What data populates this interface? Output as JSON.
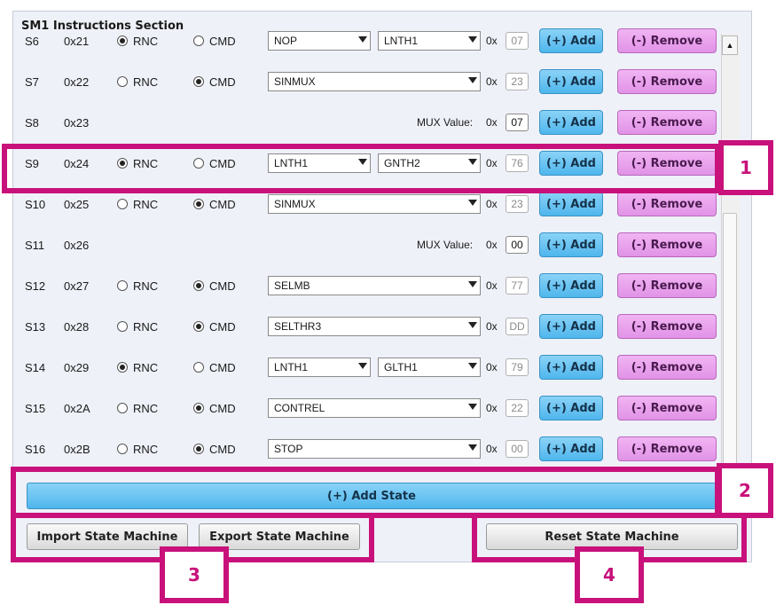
{
  "section_title": "SM1 Instructions Section",
  "labels": {
    "rnc": "RNC",
    "cmd": "CMD",
    "ox": "0x",
    "mux_value": "MUX Value:"
  },
  "buttons": {
    "add": "(+) Add",
    "remove": "(-) Remove",
    "add_state": "(+) Add State",
    "import": "Import State Machine",
    "export": "Export State Machine",
    "reset": "Reset State Machine"
  },
  "callouts": [
    "1",
    "2",
    "3",
    "4"
  ],
  "colors": {
    "highlight": "#c8117a",
    "add_blue": "#4fb6ec",
    "remove_pink": "#e193e6"
  },
  "rows": [
    {
      "id": "S6",
      "hex": "0x21",
      "mode": "RNC",
      "dd1": "NOP",
      "dd2": "LNTH1",
      "value": "07"
    },
    {
      "id": "S7",
      "hex": "0x22",
      "mode": "CMD",
      "dd1": "SINMUX",
      "value": "23"
    },
    {
      "id": "S8",
      "hex": "0x23",
      "mode": "MUX",
      "value": "07"
    },
    {
      "id": "S9",
      "hex": "0x24",
      "mode": "RNC",
      "dd1": "LNTH1",
      "dd2": "GNTH2",
      "value": "76"
    },
    {
      "id": "S10",
      "hex": "0x25",
      "mode": "CMD",
      "dd1": "SINMUX",
      "value": "23"
    },
    {
      "id": "S11",
      "hex": "0x26",
      "mode": "MUX",
      "value": "00"
    },
    {
      "id": "S12",
      "hex": "0x27",
      "mode": "CMD",
      "dd1": "SELMB",
      "value": "77"
    },
    {
      "id": "S13",
      "hex": "0x28",
      "mode": "CMD",
      "dd1": "SELTHR3",
      "value": "DD"
    },
    {
      "id": "S14",
      "hex": "0x29",
      "mode": "RNC",
      "dd1": "LNTH1",
      "dd2": "GLTH1",
      "value": "79"
    },
    {
      "id": "S15",
      "hex": "0x2A",
      "mode": "CMD",
      "dd1": "CONTREL",
      "value": "22"
    },
    {
      "id": "S16",
      "hex": "0x2B",
      "mode": "CMD",
      "dd1": "STOP",
      "value": "00"
    }
  ]
}
